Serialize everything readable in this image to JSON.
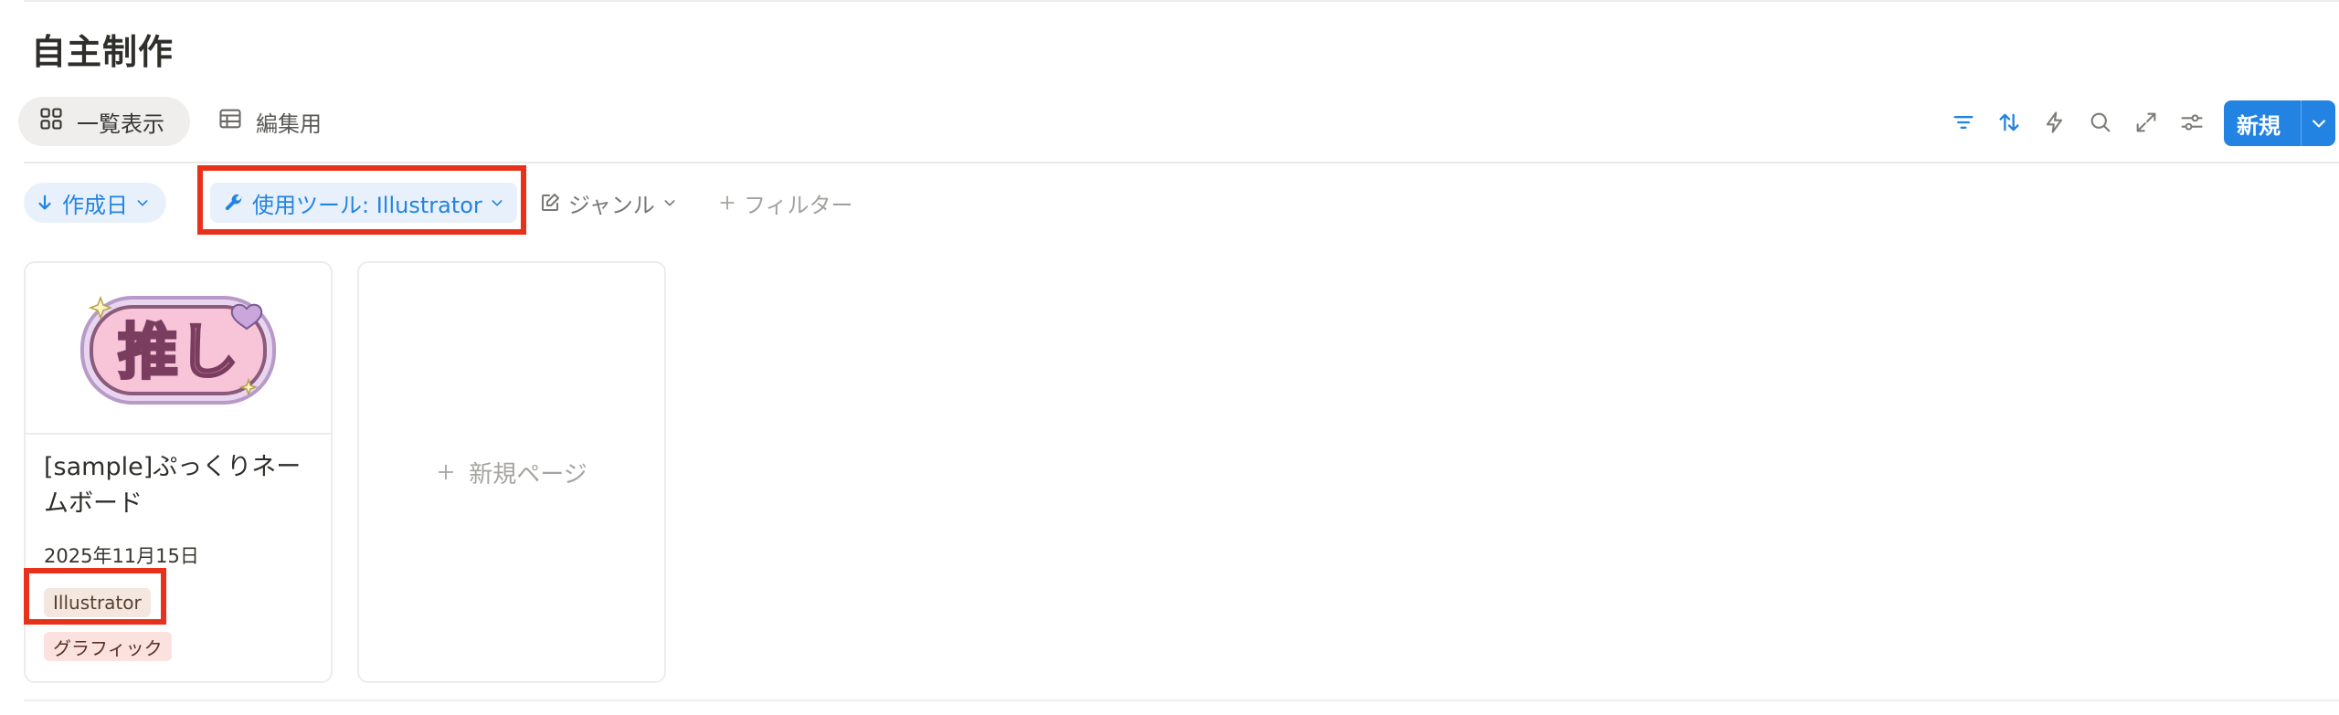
{
  "page": {
    "title": "自主制作"
  },
  "views": [
    {
      "label": "一覧表示",
      "icon": "gallery-grid-icon",
      "active": true
    },
    {
      "label": "編集用",
      "icon": "table-icon",
      "active": false
    }
  ],
  "toolbar": {
    "icons": [
      "filter-icon",
      "sort-icon",
      "automation-bolt-icon",
      "search-icon",
      "expand-icon",
      "settings-sliders-icon"
    ],
    "new_label": "新規"
  },
  "filters": {
    "sort_label": "作成日",
    "tool_label": "使用ツール: Illustrator",
    "genre_label": "ジャンル",
    "add_filter_label": "フィルター"
  },
  "cards": [
    {
      "title": "[sample]ぷっくりネームボード",
      "date": "2025年11月15日",
      "tags": [
        "Illustrator",
        "グラフィック"
      ],
      "thumbnail_text": "推し"
    }
  ],
  "new_page_label": "新規ページ",
  "colors": {
    "accent": "#2383e2",
    "highlight": "#e8311a"
  }
}
